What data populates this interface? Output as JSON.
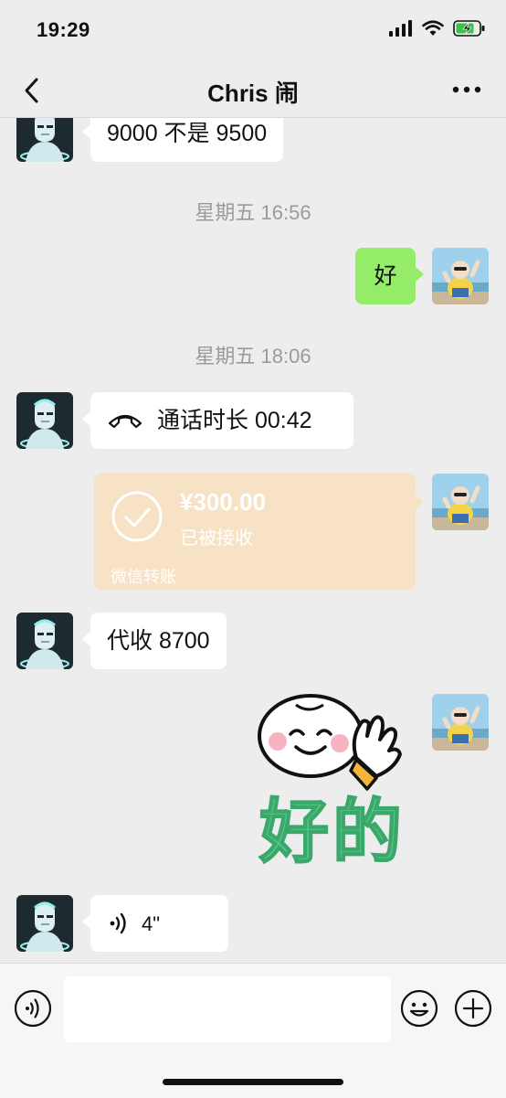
{
  "status_bar": {
    "time": "19:29",
    "battery_state": "charging"
  },
  "header": {
    "title": "Chris 闹"
  },
  "messages": [
    {
      "side": "left",
      "type": "text",
      "text": "9000 不是 9500"
    },
    {
      "type": "timestamp",
      "text": "星期五 16:56"
    },
    {
      "side": "right",
      "type": "text",
      "text": "好"
    },
    {
      "type": "timestamp",
      "text": "星期五 18:06"
    },
    {
      "side": "left",
      "type": "call",
      "text": "通话时长 00:42"
    },
    {
      "side": "right",
      "type": "transfer",
      "amount": "¥300.00",
      "status": "已被接收",
      "footer": "微信转账"
    },
    {
      "side": "left",
      "type": "text",
      "text": "代收 8700"
    },
    {
      "side": "right",
      "type": "sticker",
      "text": "好的"
    },
    {
      "side": "left",
      "type": "voice",
      "duration": "4\""
    }
  ],
  "input": {
    "placeholder": ""
  },
  "icons": {
    "back": "chevron-left-icon",
    "more": "more-dots-icon",
    "call": "phone-hangup-icon",
    "voice": "voice-wave-icon",
    "emoji": "smiley-icon",
    "plus": "plus-circle-icon"
  },
  "colors": {
    "background": "#ededed",
    "sent_bubble": "#95ec69",
    "received_bubble": "#ffffff",
    "transfer_card": "#f8e2c5",
    "timestamp_text": "#9b9b9b",
    "sticker_text": "#5cc98a"
  }
}
